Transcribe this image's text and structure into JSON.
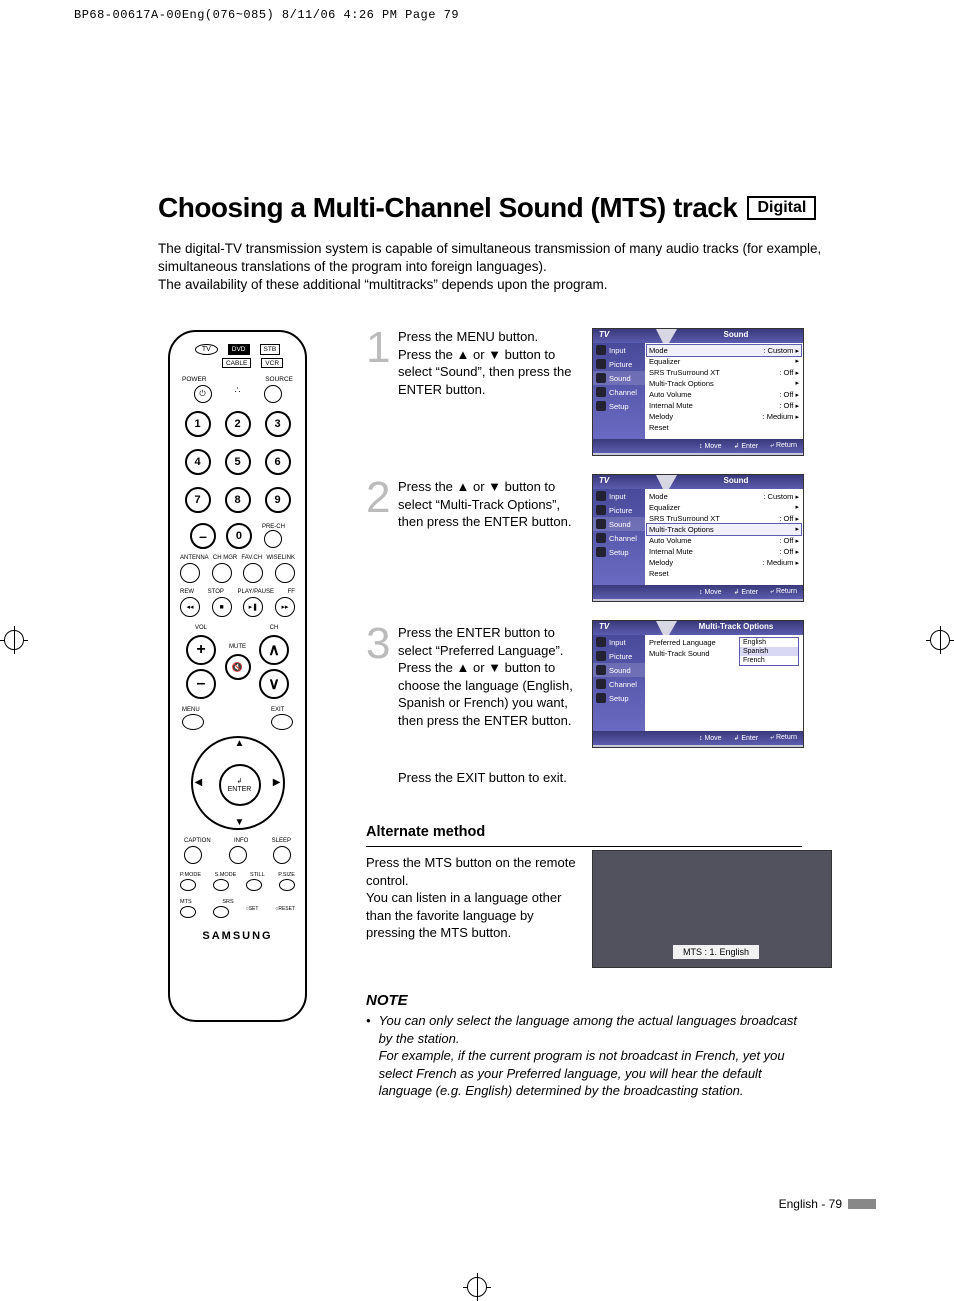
{
  "printHeader": "BP68-00617A-00Eng(076~085)  8/11/06  4:26 PM  Page 79",
  "title": "Choosing a Multi-Channel Sound (MTS) track",
  "digitalBadge": "Digital",
  "intro": "The digital-TV transmission system is capable of simultaneous transmission of many audio tracks (for example, simultaneous translations of the program into foreign languages).\nThe availability of these additional “multitracks” depends upon the program.",
  "remote": {
    "modes": {
      "tv": "TV",
      "dvd": "DVD",
      "stb": "STB",
      "cable": "CABLE",
      "vcr": "VCR"
    },
    "power": "POWER",
    "source": "SOURCE",
    "nums": [
      "1",
      "2",
      "3",
      "4",
      "5",
      "6",
      "7",
      "8",
      "9",
      "0"
    ],
    "dash": "–",
    "prech": "PRE-CH",
    "ant": "ANTENNA",
    "chmgr": "CH MGR",
    "favch": "FAV.CH",
    "wise": "WISELINK",
    "rew": "REW",
    "stop": "STOP",
    "play": "PLAY/PAUSE",
    "ff": "FF",
    "vol": "VOL",
    "mute": "MUTE",
    "ch": "CH",
    "menu": "MENU",
    "exit": "EXIT",
    "enter": "ENTER",
    "enterIcon": "↲",
    "caption": "CAPTION",
    "info": "INFO",
    "sleep": "SLEEP",
    "pmode": "P.MODE",
    "smode": "S.MODE",
    "still": "STILL",
    "psize": "P.SIZE",
    "mts": "MTS",
    "srs": "SRS",
    "set": "SET",
    "reset": "RESET",
    "brand": "SAMSUNG"
  },
  "steps": {
    "s1": {
      "n": "1",
      "t": "Press the MENU button.\nPress the ▲ or ▼ button to select “Sound”, then press the ENTER button."
    },
    "s2": {
      "n": "2",
      "t": "Press the ▲ or ▼ button to select “Multi-Track Options”, then press the ENTER button."
    },
    "s3": {
      "n": "3",
      "t": "Press the ENTER button to select “Preferred Language”. Press the ▲ or ▼ button to choose the language (English, Spanish or French) you want, then press the ENTER button."
    }
  },
  "exitText": "Press the EXIT button to exit.",
  "osd": {
    "tvLabel": "TV",
    "soundTitle": "Sound",
    "mtoTitle": "Multi-Track Options",
    "side": {
      "input": "Input",
      "picture": "Picture",
      "sound": "Sound",
      "channel": "Channel",
      "setup": "Setup"
    },
    "rows": {
      "mode": {
        "l": "Mode",
        "v": ": Custom"
      },
      "eq": {
        "l": "Equalizer",
        "v": ""
      },
      "srs": {
        "l": "SRS TruSurround XT",
        "v": ": Off"
      },
      "mto": {
        "l": "Multi-Track Options",
        "v": ""
      },
      "av": {
        "l": "Auto Volume",
        "v": ": Off"
      },
      "im": {
        "l": "Internal Mute",
        "v": ": Off"
      },
      "mel": {
        "l": "Melody",
        "v": ": Medium"
      },
      "reset": {
        "l": "Reset",
        "v": ""
      }
    },
    "mtoRows": {
      "pref": {
        "l": "Preferred Language",
        "v": ""
      },
      "mts": {
        "l": "Multi-Track Sound",
        "v": ""
      }
    },
    "langs": {
      "en": "English",
      "es": "Spanish",
      "fr": "French"
    },
    "footer": {
      "move": "↕ Move",
      "enter": "↲ Enter",
      "return": "⤶ Return"
    }
  },
  "alt": {
    "title": "Alternate method",
    "text": "Press the MTS button on the remote control.\nYou can listen in a language other than the favorite language by pressing the MTS button.",
    "badge": "MTS : 1. English"
  },
  "note": {
    "title": "NOTE",
    "text": "You can only select the language among the actual languages broadcast by the station.\nFor example, if the current program is not broadcast in French, yet you select French as your Preferred language, you will hear the default language (e.g. English) determined by the broadcasting station."
  },
  "footerPage": "English - 79"
}
